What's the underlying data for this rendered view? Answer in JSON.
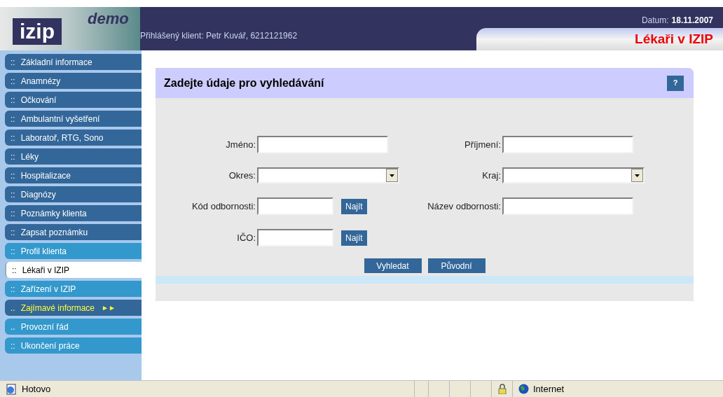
{
  "header": {
    "logo": "izip",
    "logo_badge": "demo",
    "client": "Přihlášený klient: Petr Kuvář, 6212121962",
    "date_label": "Datum:",
    "date": "18.11.2007",
    "page_title": "Lékaři v IZIP"
  },
  "sidebar": {
    "items": [
      {
        "prefix": "::",
        "label": "Základní informace",
        "kind": "dark",
        "selected": false
      },
      {
        "prefix": "::",
        "label": "Anamnézy",
        "kind": "dark",
        "selected": false
      },
      {
        "prefix": "::",
        "label": "Očkování",
        "kind": "dark",
        "selected": false
      },
      {
        "prefix": "::",
        "label": "Ambulantní vyšetření",
        "kind": "dark",
        "selected": false
      },
      {
        "prefix": "::",
        "label": "Laboratoř, RTG, Sono",
        "kind": "dark",
        "selected": false
      },
      {
        "prefix": "::",
        "label": "Léky",
        "kind": "dark",
        "selected": false
      },
      {
        "prefix": "::",
        "label": "Hospitalizace",
        "kind": "dark",
        "selected": false
      },
      {
        "prefix": "::",
        "label": "Diagnózy",
        "kind": "dark",
        "selected": false
      },
      {
        "prefix": "::",
        "label": "Poznámky klienta",
        "kind": "dark",
        "selected": false
      },
      {
        "prefix": "::",
        "label": "Zapsat poznámku",
        "kind": "dark",
        "selected": false
      },
      {
        "prefix": "::",
        "label": "Profil klienta",
        "kind": "light",
        "selected": false
      },
      {
        "prefix": "::",
        "label": "Lékaři v IZIP",
        "selected": true
      },
      {
        "prefix": "::",
        "label": "Zařízení v IZIP",
        "kind": "light",
        "selected": false
      },
      {
        "prefix": "..",
        "label": "Zajímavé informace",
        "kind": "highlight",
        "selected": false,
        "arrow": "►►"
      },
      {
        "prefix": "..",
        "label": "Provozní řád",
        "kind": "light",
        "selected": false
      },
      {
        "prefix": "::",
        "label": "Ukončení práce",
        "kind": "light",
        "selected": false
      }
    ]
  },
  "form": {
    "title": "Zadejte údaje pro vyhledávání",
    "help": "?",
    "rows": [
      [
        {
          "label": "Jméno:",
          "kind": "text"
        },
        {
          "label": "Příjmení:",
          "kind": "text"
        }
      ],
      [
        {
          "label": "Okres:",
          "kind": "select"
        },
        {
          "label": "Kraj:",
          "kind": "select"
        }
      ],
      [
        {
          "label": "Kód odbornosti:",
          "kind": "short",
          "button": "Najít"
        },
        {
          "label": "Název odbornosti:",
          "kind": "text"
        }
      ],
      [
        {
          "label": "IČO:",
          "kind": "short",
          "button": "Najít"
        }
      ]
    ],
    "buttons": [
      "Vyhledat",
      "Původní"
    ]
  },
  "status_bar": {
    "text": "Hotovo",
    "zone": "Internet"
  }
}
